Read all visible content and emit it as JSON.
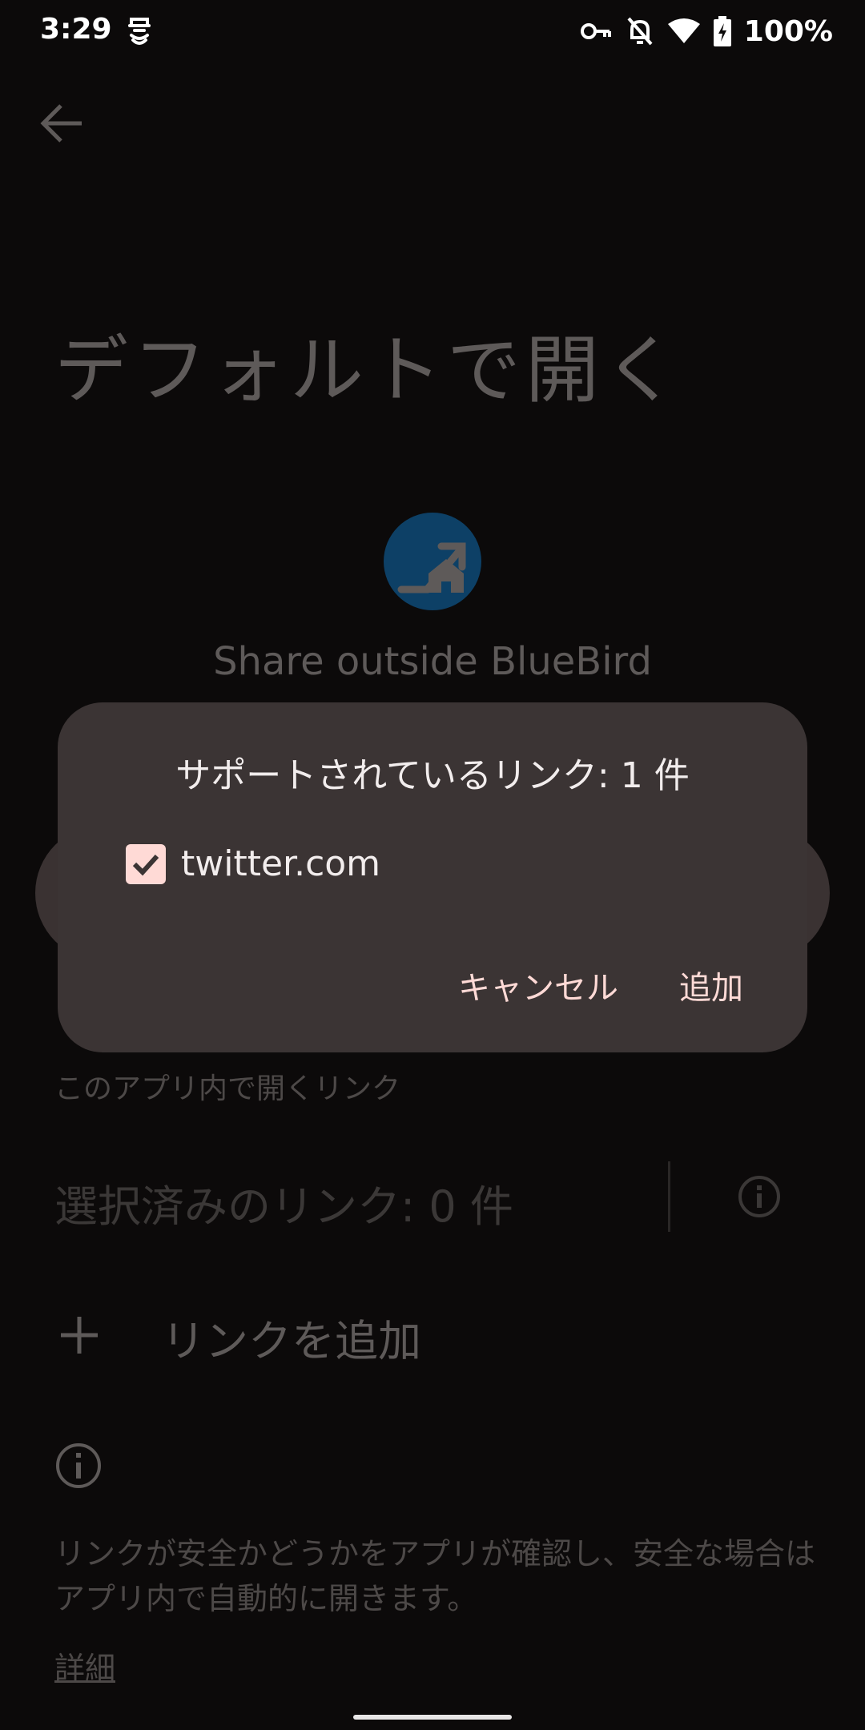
{
  "status_bar": {
    "time": "3:29",
    "battery": "100%",
    "icons": [
      "app-notification-icon",
      "vpn-key-icon",
      "notifications-off-icon",
      "wifi-icon",
      "battery-charging-icon"
    ]
  },
  "page": {
    "back_icon": "arrow-left-icon",
    "title": "デフォルトで開く",
    "app_name": "Share outside BlueBird",
    "section_label": "このアプリ内で開くリンク",
    "selected_links": "選択済みのリンク: 0 件",
    "add_link": "リンクを追加",
    "description": "リンクが安全かどうかをアプリが確認し、安全な場合はアプリ内で自動的に開きます。",
    "details": "詳細"
  },
  "dialog": {
    "title": "サポートされているリンク: 1 件",
    "items": [
      {
        "label": "twitter.com",
        "checked": true
      }
    ],
    "cancel": "キャンセル",
    "confirm": "追加"
  },
  "colors": {
    "background": "#0c0a0a",
    "dialog": "#3b3434",
    "accent": "#ffdad6",
    "app_icon": "#0d4066"
  }
}
